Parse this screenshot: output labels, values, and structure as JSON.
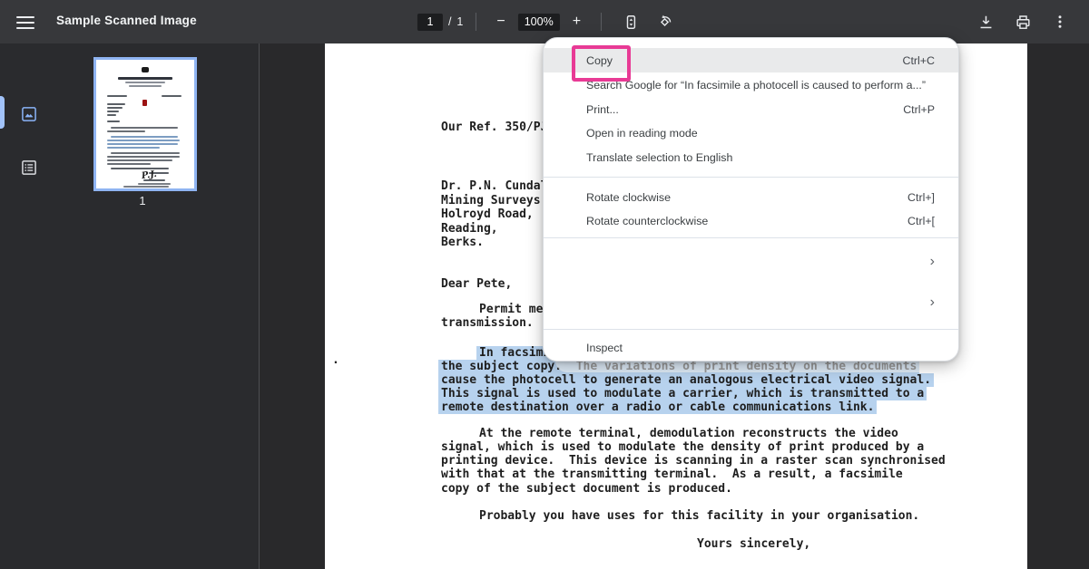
{
  "toolbar": {
    "title": "Sample Scanned Image",
    "page_current": "1",
    "page_divider": "/",
    "page_total": "1",
    "zoom_out": "−",
    "zoom_level": "100%",
    "zoom_in": "+"
  },
  "sidebar": {
    "thumbnail_page_label": "1"
  },
  "letter": {
    "lines": [
      "Our Ref. 350/PJ",
      "Dr. P.N. Cundal",
      "Mining Surveys",
      "Holroyd Road,",
      "Reading,",
      "Berks.",
      "Dear Pete,",
      "Permit me",
      "transmission.",
      "In facsimi",
      "the subject copy.  The variations of print density on the documents",
      "cause the photocell to generate an analogous electrical video signal.",
      "This signal is used to modulate a carrier, which is transmitted to a",
      "remote destination over a radio or cable communications link.",
      "At the remote terminal, demodulation reconstructs the video",
      "signal, which is used to modulate the density of print produced by a",
      "printing device.  This device is scanning in a raster scan synchronised",
      "with that at the transmitting terminal.  As a result, a facsimile",
      "copy of the subject document is produced.",
      "Probably you have uses for this facility in your organisation.",
      "Yours sincerely,"
    ],
    "artifact": "."
  },
  "context_menu": {
    "submenu_chevron": "›",
    "items": [
      {
        "label": "Copy",
        "shortcut": "Ctrl+C"
      },
      {
        "label": "Search Google for “In facsimile a photocell is caused to perform a...”",
        "shortcut": ""
      },
      {
        "label": "Print...",
        "shortcut": "Ctrl+P"
      },
      {
        "label": "Open in reading mode",
        "shortcut": ""
      },
      {
        "label": "Translate selection to English",
        "shortcut": ""
      },
      {
        "label": "Rotate clockwise",
        "shortcut": "Ctrl+]"
      },
      {
        "label": "Rotate counterclockwise",
        "shortcut": "Ctrl+["
      },
      {
        "label": "",
        "shortcut": ""
      },
      {
        "label": "",
        "shortcut": ""
      },
      {
        "label": "Inspect",
        "shortcut": ""
      }
    ]
  },
  "annotation": {
    "highlight_color": "#e83a95",
    "selection_color": "#b7d2ee"
  }
}
